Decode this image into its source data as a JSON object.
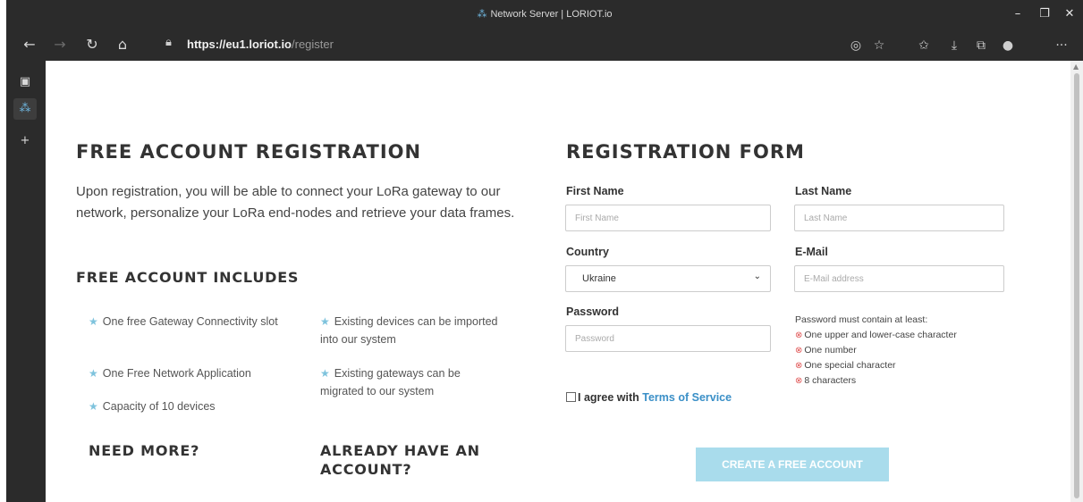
{
  "browser": {
    "window_title": "Network Server | LORIOT.io",
    "url_host": "https://eu1.loriot.io",
    "url_path": "/register"
  },
  "page": {
    "left_title": "FREE ACCOUNT REGISTRATION",
    "intro": "Upon registration, you will be able to connect your LoRa gateway to our network, personalize your LoRa end-nodes and retrieve your data frames.",
    "includes_title": "FREE ACCOUNT INCLUDES",
    "features": [
      "One free Gateway Connectivity slot",
      "One Free Network Application",
      "Capacity of 10 devices",
      "Existing devices can be imported into our system",
      "Existing gateways can be migrated to our system"
    ],
    "need_more_title": "NEED MORE?",
    "already_title": "ALREADY HAVE AN ACCOUNT?"
  },
  "form": {
    "title": "REGISTRATION FORM",
    "first_name_label": "First Name",
    "first_name_placeholder": "First Name",
    "last_name_label": "Last Name",
    "last_name_placeholder": "Last Name",
    "country_label": "Country",
    "country_value": "Ukraine",
    "email_label": "E-Mail",
    "email_placeholder": "E-Mail address",
    "password_label": "Password",
    "password_placeholder": "Password",
    "password_rules_title": "Password must contain at least:",
    "password_rules": [
      "One upper and lower-case character",
      "One number",
      "One special character",
      "8 characters"
    ],
    "agree_text": "I agree with",
    "terms_link": "Terms of Service",
    "submit_label": "CREATE A FREE ACCOUNT"
  },
  "colors": {
    "accent": "#3a8fc7",
    "button_disabled": "#a9dcec",
    "star": "#7ec3dd",
    "rule_error": "#e05555"
  }
}
